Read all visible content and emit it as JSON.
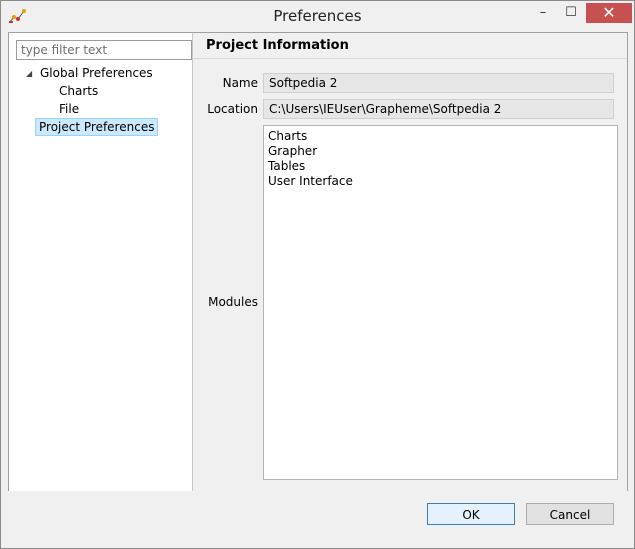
{
  "window": {
    "title": "Preferences",
    "app_icon": "grapheme-app-icon",
    "controls": {
      "minimize": "–",
      "maximize": "☐",
      "close": "✕"
    }
  },
  "sidebar": {
    "filter_placeholder": "type filter text",
    "tree": [
      {
        "label": "Global Preferences",
        "expanded": true,
        "children": [
          {
            "label": "Charts"
          },
          {
            "label": "File"
          }
        ]
      },
      {
        "label": "Project Preferences",
        "selected": true
      }
    ]
  },
  "main": {
    "section_title": "Project Information",
    "name_label": "Name",
    "name_value": "Softpedia 2",
    "location_label": "Location",
    "location_value": "C:\\Users\\IEUser\\Grapheme\\Softpedia 2",
    "modules_label": "Modules",
    "modules": [
      "Charts",
      "Grapher",
      "Tables",
      "User Interface"
    ]
  },
  "buttons": {
    "ok": "OK",
    "cancel": "Cancel"
  },
  "colors": {
    "selection_bg": "#cce8ff",
    "close_button": "#c75050",
    "ok_border": "#3c7fb1"
  }
}
